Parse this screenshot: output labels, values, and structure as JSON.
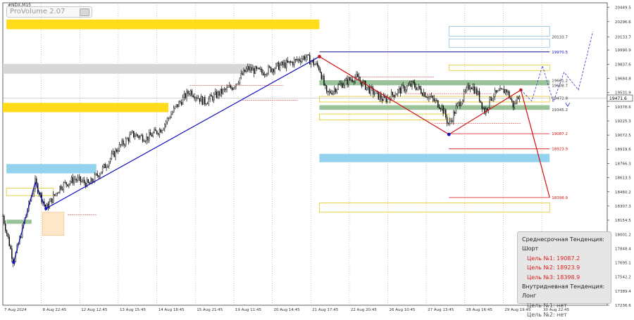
{
  "toolbar": {
    "symbol": "#NDX,M15",
    "indicator_label": "ProVolume 2.07"
  },
  "colors": {
    "up_trend": "#1010c0",
    "down_trend": "#d01010",
    "candle": "#000000",
    "bg": "#ffffff",
    "gold_zone": "#ffd700",
    "blue_zone": "#87ceeb",
    "gray_zone": "#d3d3d3",
    "green_zone": "#8fbc8f"
  },
  "chart_data": {
    "type": "candlestick",
    "title": "",
    "xlabel": "",
    "ylabel": "",
    "ylim": [
      17236.6,
      20500
    ],
    "grid": "vertical dotted",
    "y_ticks": [
      20449.5,
      20296.6,
      20133.7,
      19990.9,
      19837.6,
      19684.8,
      19531.9,
      19378.6,
      19225.3,
      19072.5,
      18919.6,
      18766.3,
      18613.5,
      18460.2,
      18307.3,
      18154.5,
      18001.2,
      17848.4,
      17695.1,
      17542.2,
      17389.4,
      17236.6
    ],
    "x_ticks": [
      "7 Aug 2024",
      "8 Aug 22:45",
      "12 Aug 12:45",
      "13 Aug 15:45",
      "14 Aug 18:45",
      "15 Aug 21:45",
      "19 Aug 11:45",
      "20 Aug 14:45",
      "21 Aug 17:45",
      "22 Aug 20:45",
      "26 Aug 10:45",
      "27 Aug 13:45",
      "28 Aug 16:45",
      "29 Aug 19:45",
      "30 Aug 22:45"
    ],
    "current_price": "19471.6",
    "level_labels": [
      {
        "label": "20133.7",
        "value": 20133.7,
        "color": "#333333"
      },
      {
        "label": "19970.5",
        "value": 19970.5,
        "color": "#1010c0"
      },
      {
        "label": "19661.2",
        "value": 19661.2,
        "color": "#333333"
      },
      {
        "label": "19608.7",
        "value": 19608.7,
        "color": "#333333"
      },
      {
        "label": "19472.8",
        "value": 19472.8,
        "color": "#333333"
      },
      {
        "label": "19345.2",
        "value": 19345.2,
        "color": "#333333"
      },
      {
        "label": "19087.2",
        "value": 19087.2,
        "color": "#d01010"
      },
      {
        "label": "18923.9",
        "value": 18923.9,
        "color": "#d01010"
      },
      {
        "label": "18398.9",
        "value": 18398.9,
        "color": "#d01010"
      }
    ],
    "price_path": [
      {
        "t": 0,
        "v": 18200
      },
      {
        "t": 1.5,
        "v": 17700
      },
      {
        "t": 3,
        "v": 18150
      },
      {
        "t": 4.5,
        "v": 18560
      },
      {
        "t": 6,
        "v": 18280
      },
      {
        "t": 8,
        "v": 18520
      },
      {
        "t": 10,
        "v": 18600
      },
      {
        "t": 12,
        "v": 18540
      },
      {
        "t": 14,
        "v": 18720
      },
      {
        "t": 16,
        "v": 18930
      },
      {
        "t": 18,
        "v": 19080
      },
      {
        "t": 20,
        "v": 19040
      },
      {
        "t": 22,
        "v": 19140
      },
      {
        "t": 24,
        "v": 19370
      },
      {
        "t": 26,
        "v": 19550
      },
      {
        "t": 28,
        "v": 19430
      },
      {
        "t": 30,
        "v": 19520
      },
      {
        "t": 32,
        "v": 19600
      },
      {
        "t": 34,
        "v": 19790
      },
      {
        "t": 36,
        "v": 19750
      },
      {
        "t": 38,
        "v": 19810
      },
      {
        "t": 40,
        "v": 19850
      },
      {
        "t": 42,
        "v": 19920
      },
      {
        "t": 44,
        "v": 19800
      },
      {
        "t": 45,
        "v": 19510
      },
      {
        "t": 47,
        "v": 19620
      },
      {
        "t": 49,
        "v": 19700
      },
      {
        "t": 51,
        "v": 19560
      },
      {
        "t": 53,
        "v": 19450
      },
      {
        "t": 55,
        "v": 19550
      },
      {
        "t": 57,
        "v": 19620
      },
      {
        "t": 59,
        "v": 19500
      },
      {
        "t": 61,
        "v": 19380
      },
      {
        "t": 62,
        "v": 19180
      },
      {
        "t": 63,
        "v": 19360
      },
      {
        "t": 65,
        "v": 19620
      },
      {
        "t": 66,
        "v": 19520
      },
      {
        "t": 67,
        "v": 19320
      },
      {
        "t": 68,
        "v": 19500
      },
      {
        "t": 70,
        "v": 19560
      },
      {
        "t": 71,
        "v": 19380
      },
      {
        "t": 72,
        "v": 19560
      }
    ],
    "trend_lines": [
      {
        "name": "up",
        "points": [
          [
            1.5,
            17700
          ],
          [
            4.5,
            18560
          ],
          [
            6,
            18280
          ],
          [
            44,
            19920
          ]
        ]
      },
      {
        "name": "down",
        "points": [
          [
            44,
            19920
          ],
          [
            62,
            19080
          ],
          [
            72,
            19560
          ],
          [
            76,
            18398.9
          ]
        ]
      }
    ],
    "zones": [
      {
        "kind": "gold",
        "t0": 0.5,
        "t1": 44,
        "v0": 20320,
        "v1": 20215
      },
      {
        "kind": "gray",
        "t0": 0,
        "t1": 34,
        "v0": 19840,
        "v1": 19735
      },
      {
        "kind": "gold",
        "t0": 0,
        "t1": 23,
        "v0": 19420,
        "v1": 19320
      },
      {
        "kind": "blue",
        "t0": 0.5,
        "t1": 13,
        "v0": 18760,
        "v1": 18660
      },
      {
        "kind": "blue",
        "t0": 44,
        "t1": 76,
        "v0": 18870,
        "v1": 18780
      },
      {
        "kind": "green",
        "t0": 44,
        "t1": 76,
        "v0": 19395,
        "v1": 19345
      },
      {
        "kind": "green",
        "t0": 44,
        "t1": 76,
        "v0": 19665,
        "v1": 19610
      },
      {
        "kind": "green",
        "t0": 0.5,
        "t1": 4,
        "v0": 18160,
        "v1": 18115
      }
    ],
    "forecast_dashed": [
      [
        72,
        19560
      ],
      [
        73.5,
        19440
      ],
      [
        75,
        19820
      ],
      [
        76.5,
        19430
      ],
      [
        78,
        19750
      ],
      [
        80,
        19560
      ],
      [
        82,
        20190
      ]
    ]
  },
  "panel": {
    "mid_title": "Среднесрочная Тенденция: Шорт",
    "targets_mid": [
      "Цель №1: 19087.2",
      "Цель №2: 18923.9",
      "Цель №3: 18398.9"
    ],
    "intra_title": "Внутридневная Тенденция: Лонг",
    "targets_intra": [
      "Цель №1: нет",
      "Цель №2: нет"
    ]
  }
}
